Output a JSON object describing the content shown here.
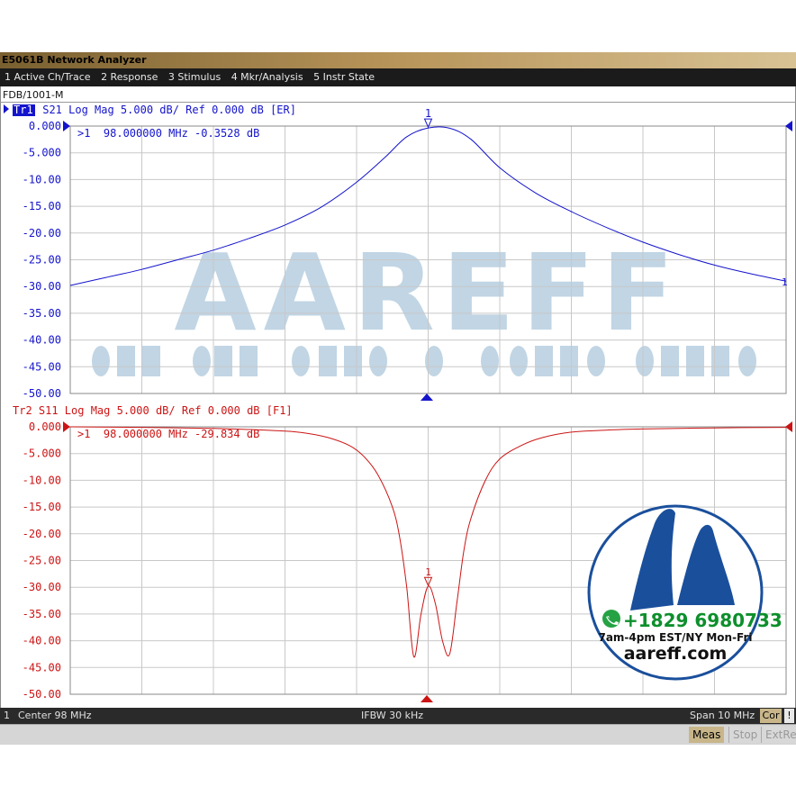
{
  "window": {
    "title": "E5061B Network Analyzer"
  },
  "menu": [
    {
      "label": "1 Active Ch/Trace"
    },
    {
      "label": "2 Response"
    },
    {
      "label": "3 Stimulus"
    },
    {
      "label": "4 Mkr/Analysis"
    },
    {
      "label": "5 Instr State"
    }
  ],
  "channel_label": "FDB/1001-M",
  "traces": [
    {
      "label": "Tr1 S21 Log Mag 5.000 dB/ Ref 0.000 dB [ER]",
      "badge": "Tr1",
      "header_rest": " S21 Log Mag 5.000 dB/ Ref 0.000 dB [ER]",
      "color": "#1414cc",
      "marker_readout": ">1  98.000000 MHz -0.3528 dB",
      "marker_number": "1",
      "yticks": [
        "0.000",
        "-5.000",
        "-10.00",
        "-15.00",
        "-20.00",
        "-25.00",
        "-30.00",
        "-35.00",
        "-40.00",
        "-45.00",
        "-50.00"
      ]
    },
    {
      "label": "Tr2 S11 Log Mag 5.000 dB/ Ref 0.000 dB [F1]",
      "color": "#cc1414",
      "marker_readout": ">1  98.000000 MHz -29.834 dB",
      "marker_number": "1",
      "yticks": [
        "0.000",
        "-5.000",
        "-10.00",
        "-15.00",
        "-20.00",
        "-25.00",
        "-30.00",
        "-35.00",
        "-40.00",
        "-45.00",
        "-50.00"
      ]
    }
  ],
  "chart_data": [
    {
      "type": "line",
      "title": "",
      "series": [
        {
          "name": "S21",
          "x": [
            93,
            93.5,
            94,
            94.5,
            95,
            95.5,
            96,
            96.5,
            97,
            97.4,
            97.7,
            98,
            98.3,
            98.6,
            99,
            99.5,
            100,
            100.5,
            101,
            101.5,
            102,
            102.5,
            103
          ],
          "y": [
            -29.8,
            -28.3,
            -26.8,
            -25.0,
            -23.2,
            -21.0,
            -18.5,
            -15.2,
            -10.5,
            -5.8,
            -2.0,
            -0.35,
            -0.4,
            -2.5,
            -7.8,
            -12.5,
            -16.0,
            -19.0,
            -21.7,
            -24.0,
            -26.0,
            -27.6,
            -29.0
          ]
        }
      ],
      "xlim": [
        93,
        103
      ],
      "ylim": [
        -50,
        0
      ],
      "grid": true,
      "marker": {
        "x": 98.0,
        "y": -0.3528
      }
    },
    {
      "type": "line",
      "title": "",
      "series": [
        {
          "name": "S11",
          "x": [
            93,
            94,
            95,
            95.5,
            96,
            96.3,
            96.6,
            96.9,
            97.1,
            97.3,
            97.5,
            97.6,
            97.7,
            97.8,
            97.9,
            98.0,
            98.1,
            98.2,
            98.3,
            98.4,
            98.5,
            98.6,
            98.8,
            99.0,
            99.3,
            99.6,
            100,
            100.5,
            101,
            102,
            103
          ],
          "y": [
            0,
            -0.1,
            -0.3,
            -0.5,
            -0.8,
            -1.2,
            -2.0,
            -3.5,
            -5.5,
            -9.0,
            -15.0,
            -20.5,
            -30.0,
            -43.0,
            -35.0,
            -29.8,
            -33.0,
            -40.0,
            -42.5,
            -33.0,
            -23.0,
            -17.0,
            -10.0,
            -6.0,
            -3.5,
            -2.0,
            -1.0,
            -0.6,
            -0.4,
            -0.2,
            -0.1
          ]
        }
      ],
      "xlim": [
        93,
        103
      ],
      "ylim": [
        -50,
        0
      ],
      "grid": true,
      "marker": {
        "x": 98.0,
        "y": -29.834
      }
    }
  ],
  "status": {
    "channel": "1",
    "center": "Center  98 MHz",
    "ifbw": "IFBW 30 kHz",
    "span": "Span 10 MHz",
    "cor": "Cor",
    "bang": "!"
  },
  "softkeys": {
    "meas": "Meas",
    "stop": "Stop",
    "extref": "ExtRef"
  },
  "watermark": {
    "text": "AAREFF",
    "phone": "+1829 6980733",
    "hours": "7am-4pm EST/NY Mon-Fri",
    "site": "aareff.com",
    "accent_color": "#8fb3cf",
    "badge_color": "#1a4f9c"
  }
}
